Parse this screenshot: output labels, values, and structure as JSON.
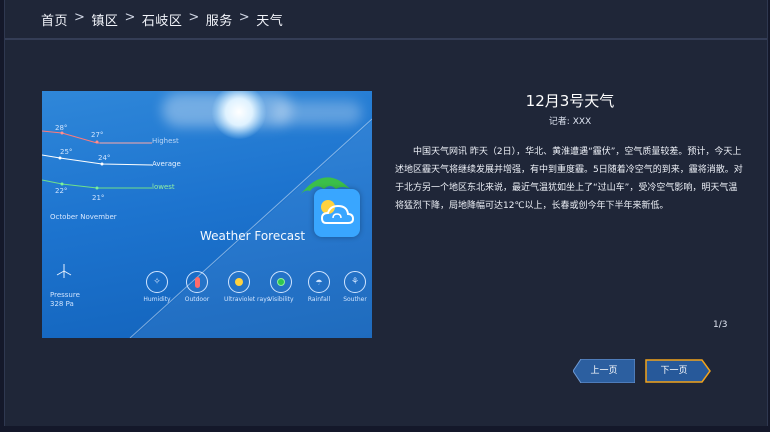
{
  "breadcrumb": {
    "items": [
      "首页",
      "镇区",
      "石岐区",
      "服务",
      "天气"
    ],
    "separator": ">"
  },
  "image": {
    "temps": {
      "highest_a": "28°",
      "highest_b": "27°",
      "average_a": "25°",
      "average_b": "24°",
      "lowest_a": "22°",
      "lowest_b": "21°"
    },
    "legend": {
      "highest": "Highest",
      "average": "Average",
      "lowest": "lowest"
    },
    "months": "October  November",
    "title": "Weather Forecast",
    "pressure_label": "Pressure",
    "pressure_value": "328  Pa",
    "icons": [
      "Humidity",
      "Outdoor",
      "Ultraviolet rays",
      "Visibility",
      "Rainfall",
      "Souther"
    ]
  },
  "article": {
    "title": "12月3号天气",
    "reporter": "记者: XXX",
    "body": "中国天气网讯 昨天（2日），华北、黄淮遭遇“霾伏”，空气质量较差。预计，今天上述地区霾天气将继续发展并增强，有中到重度霾。5日随着冷空气的到来，霾将消散。对于北方另一个地区东北来说，最近气温犹如坐上了“过山车”，受冷空气影响，明天气温将猛烈下降，局地降幅可达12℃以上，长春或创今年下半年来新低。"
  },
  "pagination": {
    "indicator": "1/3",
    "prev_label": "上一页",
    "next_label": "下一页"
  },
  "colors": {
    "background": "#1f2638",
    "accent_border": "#f2a31b",
    "button_fill": "#2c5fa0"
  }
}
